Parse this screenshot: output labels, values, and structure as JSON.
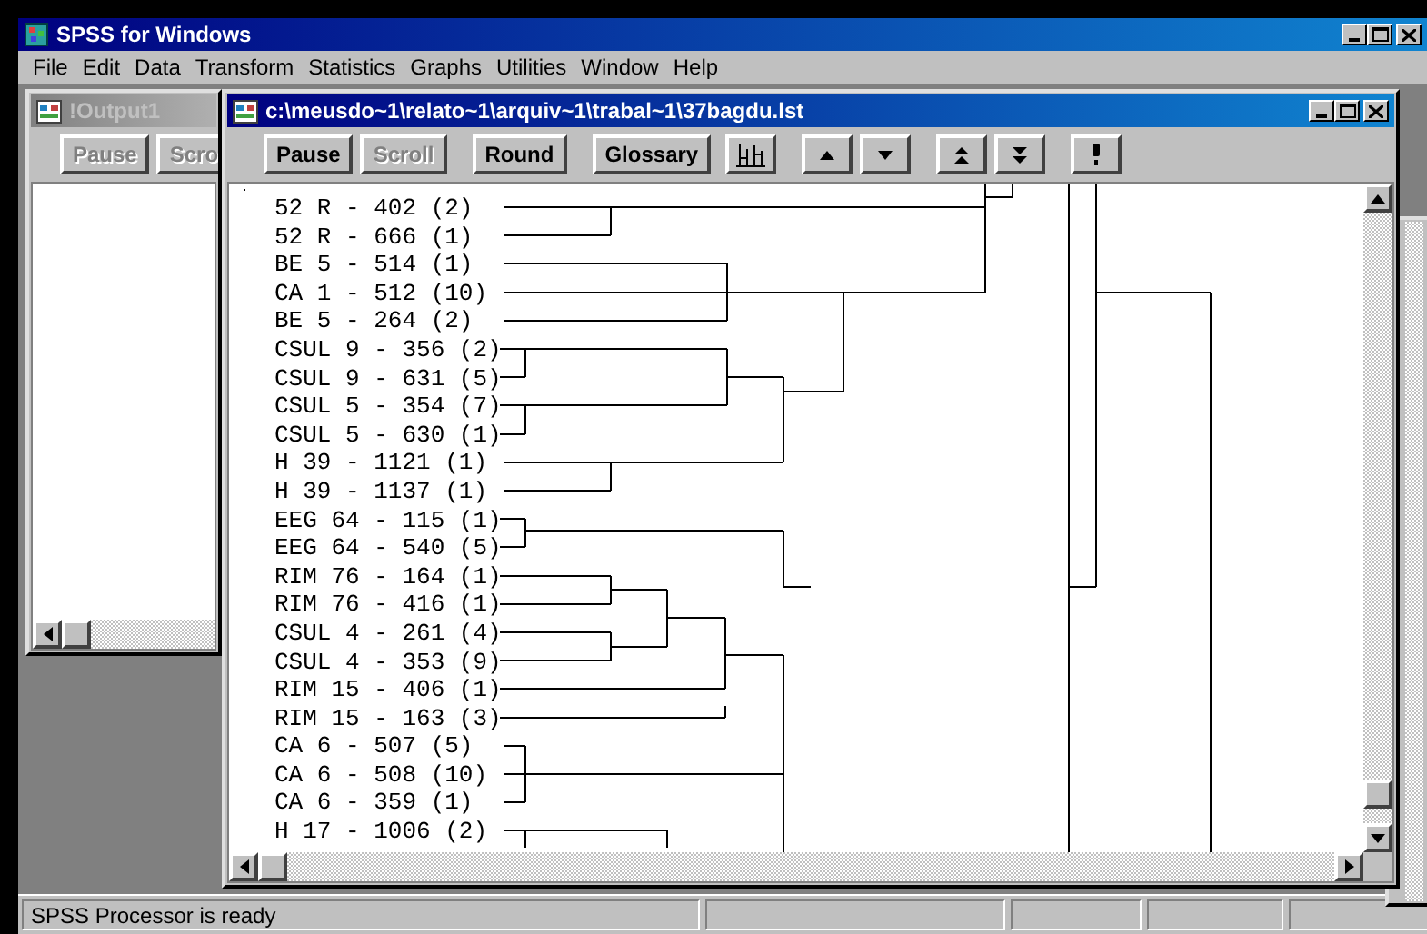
{
  "app": {
    "title": "SPSS for Windows"
  },
  "menu": [
    "File",
    "Edit",
    "Data",
    "Transform",
    "Statistics",
    "Graphs",
    "Utilities",
    "Window",
    "Help"
  ],
  "windows": [
    {
      "title": "!Output1",
      "active": false,
      "buttons": [
        {
          "label": "Pause",
          "disabled": true
        },
        {
          "label": "Scro",
          "disabled": true
        }
      ]
    },
    {
      "title": "c:\\meusdo~1\\relato~1\\arquiv~1\\trabal~1\\37bagdu.lst",
      "active": true,
      "buttons": [
        {
          "label": "Pause",
          "disabled": false
        },
        {
          "label": "Scroll",
          "disabled": true
        },
        {
          "label": "Round",
          "disabled": false
        },
        {
          "label": "Glossary",
          "disabled": false
        }
      ],
      "lines": [
        "52 R - 402 (2)",
        "52 R - 666 (1)",
        "BE 5 - 514 (1)",
        "CA 1 - 512 (10)",
        "BE 5 - 264 (2)",
        "CSUL 9 - 356 (2)",
        "CSUL 9 - 631 (5)",
        "CSUL 5 - 354 (7)",
        "CSUL 5 - 630 (1)",
        "H 39 - 1121 (1)",
        "H 39 - 1137 (1)",
        "EEG 64 - 115 (1)",
        "EEG 64 - 540 (5)",
        "RIM 76 - 164 (1)",
        "RIM 76 - 416 (1)",
        "CSUL 4 - 261 (4)",
        "CSUL 4 - 353 (9)",
        "RIM 15 - 406 (1)",
        "RIM 15 - 163 (3)",
        "CA 6 - 507 (5)",
        "CA 6 - 508 (10)",
        "CA 6 - 359 (1)",
        "H 17 - 1006 (2)"
      ]
    }
  ],
  "status_bar": [
    "SPSS Processor is ready"
  ]
}
